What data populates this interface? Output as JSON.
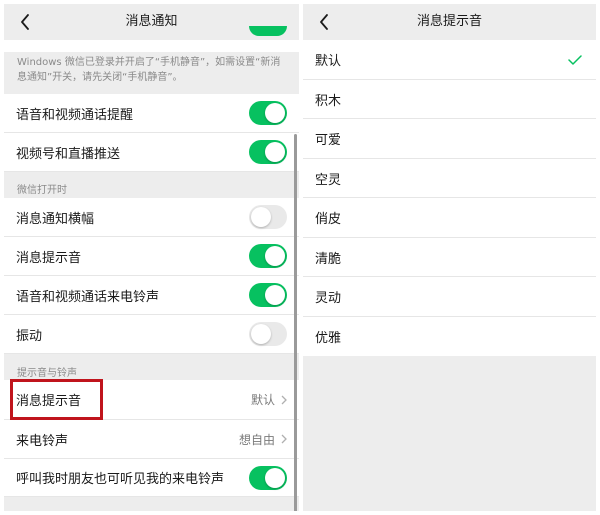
{
  "left_screen": {
    "title": "消息通知",
    "note": "Windows 微信已登录并开启了“手机静音”，如需设置“新消息通知”开关，请先关闭“手机静音”。",
    "rows_top": [
      {
        "label": "语音和视频通话提醒",
        "on": true
      },
      {
        "label": "视频号和直播推送",
        "on": true
      }
    ],
    "section_open": {
      "header": "微信打开时",
      "rows": [
        {
          "label": "消息通知横幅",
          "on": false
        },
        {
          "label": "消息提示音",
          "on": true
        },
        {
          "label": "语音和视频通话来电铃声",
          "on": true
        },
        {
          "label": "振动",
          "on": false
        }
      ]
    },
    "section_sound": {
      "header": "提示音与铃声",
      "message_tone": {
        "label": "消息提示音",
        "value": "默认"
      },
      "ringtone": {
        "label": "来电铃声",
        "value": "想自由"
      },
      "friend_ring": {
        "label": "呼叫我时朋友也可听见我的来电铃声",
        "on": true
      }
    }
  },
  "right_screen": {
    "title": "消息提示音",
    "selected_index": 0,
    "options": [
      "默认",
      "积木",
      "可爱",
      "空灵",
      "俏皮",
      "清脆",
      "灵动",
      "优雅"
    ]
  },
  "colors": {
    "accent_green": "#07c160",
    "highlight_red": "#c0141c",
    "background": "#ededed"
  },
  "icons": [
    "back-arrow-icon",
    "chevron-right-icon",
    "checkmark-icon"
  ]
}
